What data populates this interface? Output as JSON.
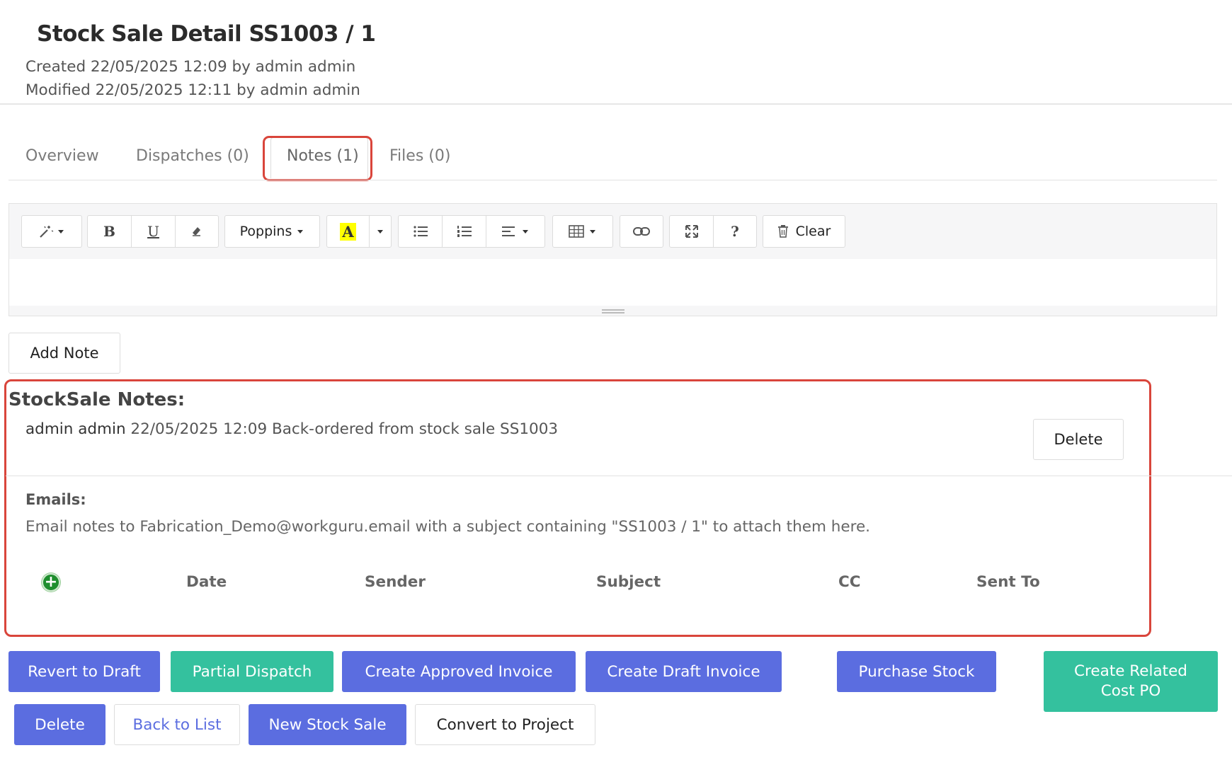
{
  "header": {
    "title": "Stock Sale Detail SS1003 / 1",
    "created": "Created 22/05/2025 12:09 by admin admin",
    "modified": "Modified 22/05/2025 12:11 by admin admin"
  },
  "tabs": [
    {
      "label": "Overview"
    },
    {
      "label": "Dispatches (0)"
    },
    {
      "label": "Notes (1)",
      "active": true
    },
    {
      "label": "Files (0)"
    }
  ],
  "editor": {
    "font_name": "Poppins",
    "clear_label": "Clear",
    "highlight_color": "#ffff00"
  },
  "add_note_label": "Add Note",
  "notes": {
    "heading": "StockSale Notes:",
    "items": [
      {
        "author": "admin admin",
        "text": "22/05/2025 12:09 Back-ordered from stock sale SS1003",
        "delete_label": "Delete"
      }
    ]
  },
  "emails": {
    "label": "Emails:",
    "info": "Email notes to Fabrication_Demo@workguru.email with a subject containing \"SS1003 / 1\" to attach them here.",
    "columns": [
      "Date",
      "Sender",
      "Subject",
      "CC",
      "Sent To"
    ]
  },
  "actions": {
    "row1": [
      {
        "label": "Revert to Draft",
        "style": "blue"
      },
      {
        "label": "Partial Dispatch",
        "style": "green"
      },
      {
        "label": "Create Approved Invoice",
        "style": "blue"
      },
      {
        "label": "Create Draft Invoice",
        "style": "blue"
      },
      {
        "label": "Purchase Stock",
        "style": "blue"
      },
      {
        "label": "Create Related Cost PO",
        "style": "green"
      }
    ],
    "row2": [
      {
        "label": "Delete",
        "style": "blue"
      },
      {
        "label": "Back to List",
        "style": "white-link"
      },
      {
        "label": "New Stock Sale",
        "style": "blue"
      },
      {
        "label": "Convert to Project",
        "style": "white"
      }
    ]
  },
  "colors": {
    "primary": "#5b6de0",
    "success": "#34c19e",
    "highlight_border": "#d9453b"
  }
}
